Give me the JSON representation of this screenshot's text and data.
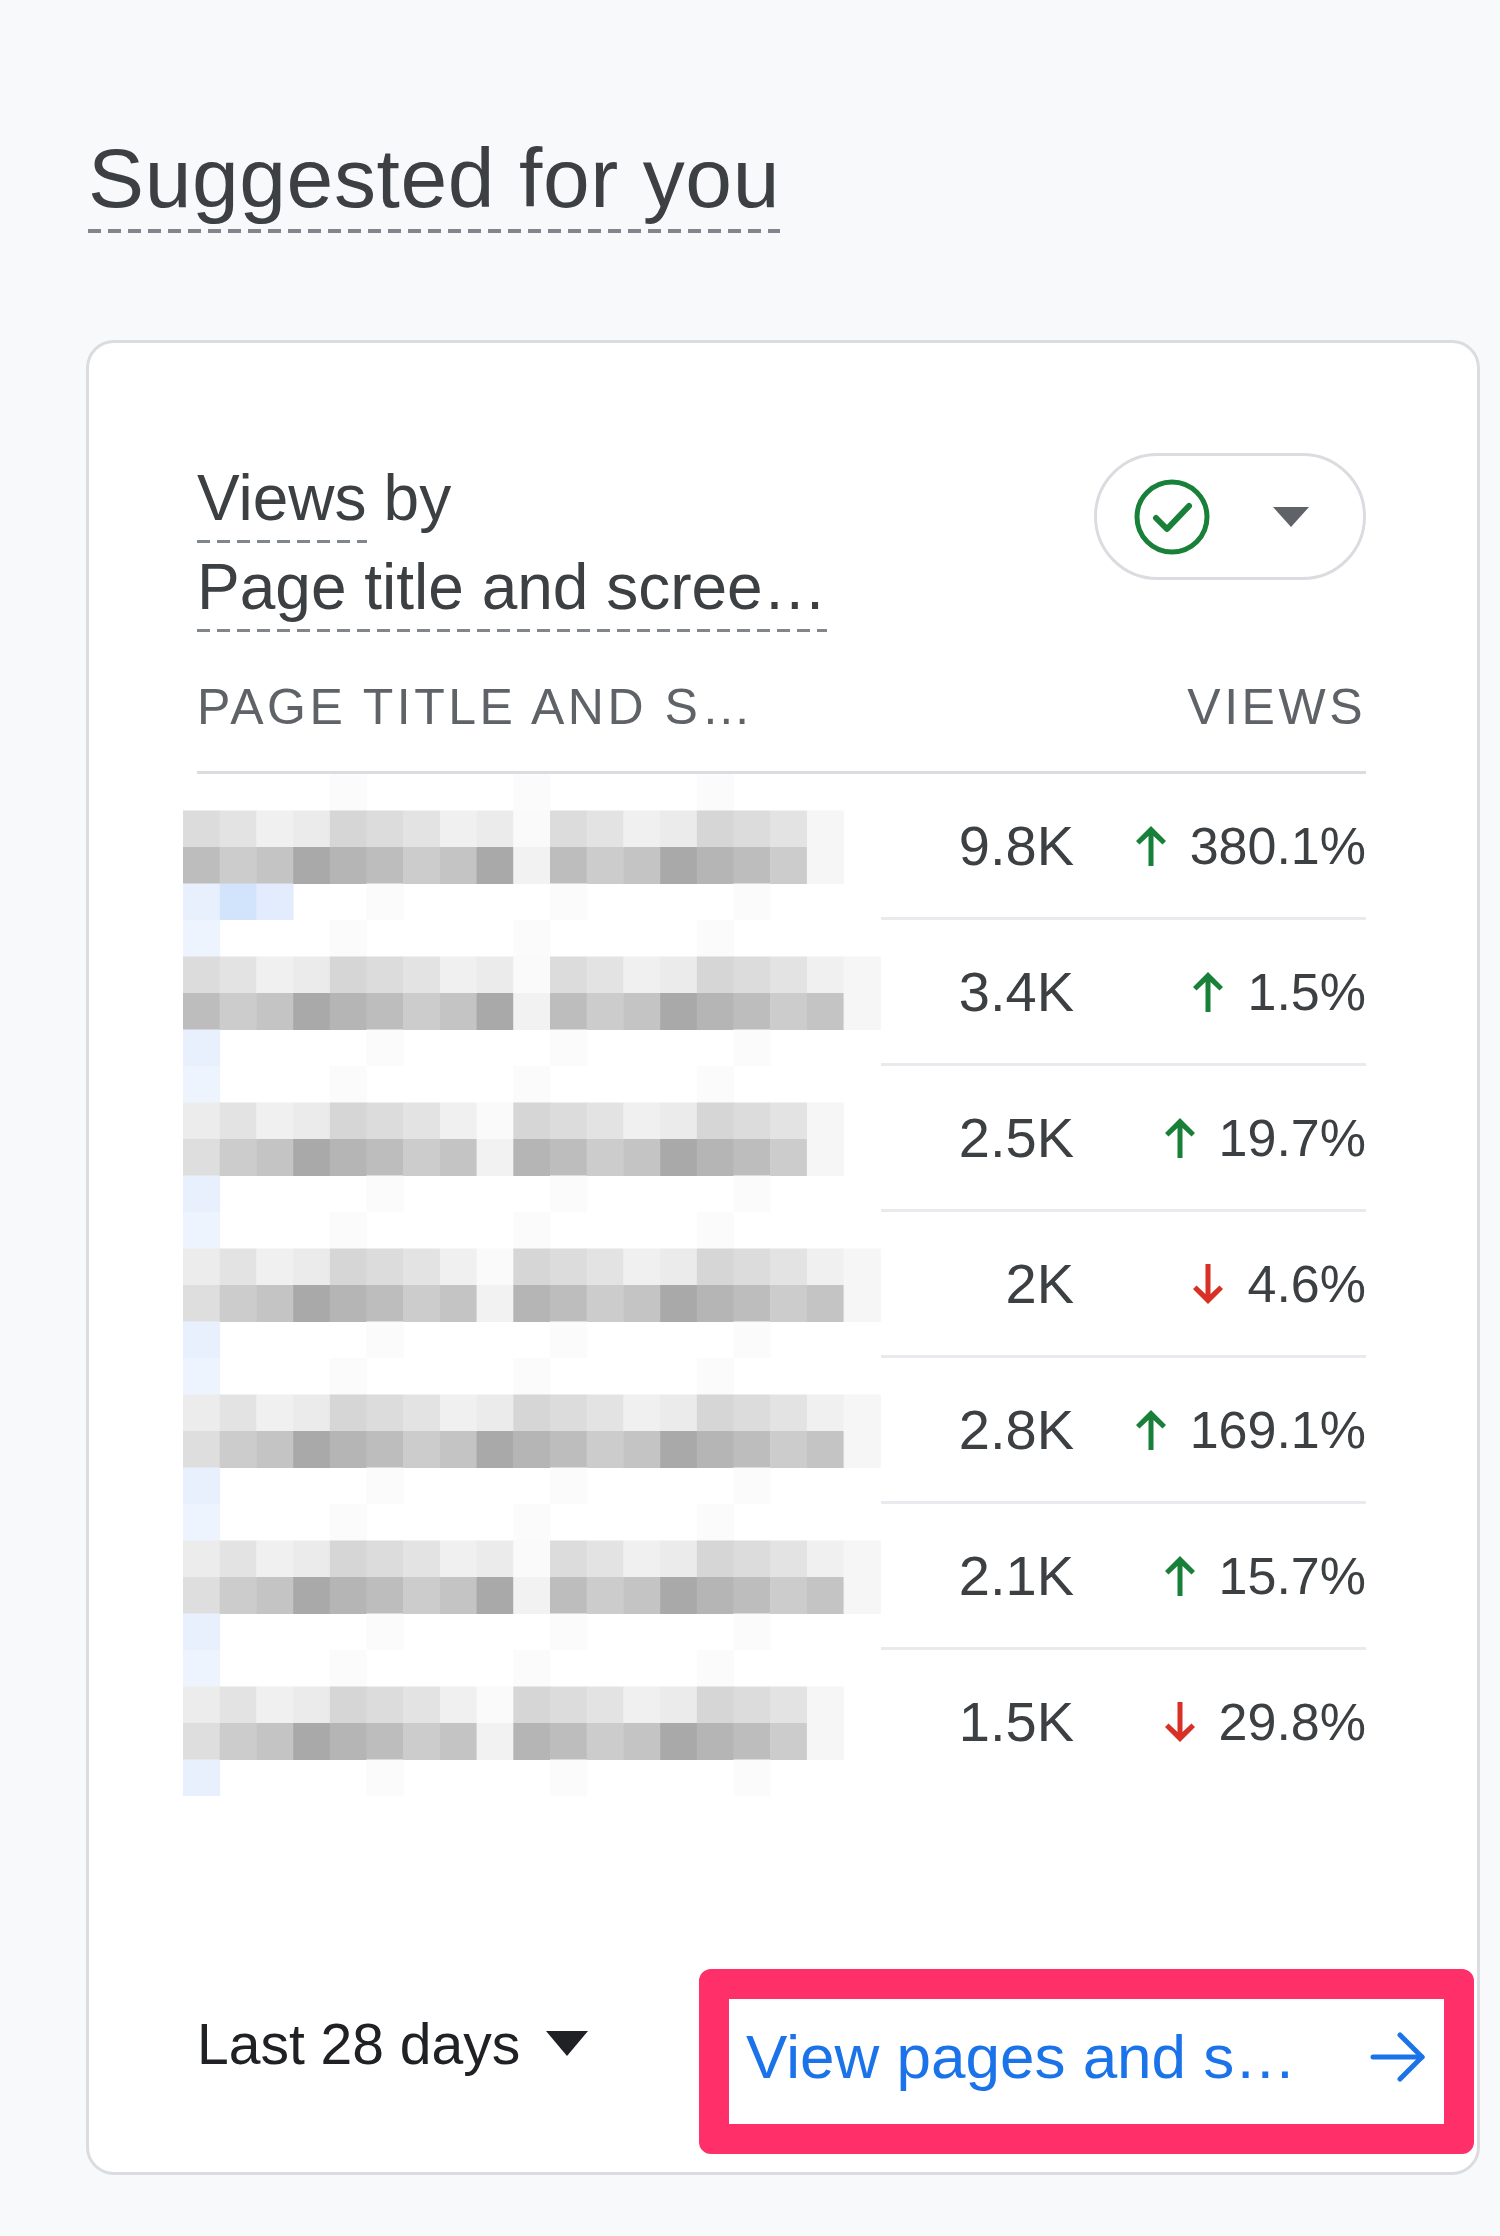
{
  "section_title": "Suggested for you",
  "card": {
    "metric": "Views",
    "connector": "by",
    "dimension": "Page title and scree…",
    "columns": [
      "PAGE TITLE AND S…",
      "VIEWS"
    ],
    "rows": [
      {
        "views": "9.8K",
        "change": "380.1%",
        "kind": "up"
      },
      {
        "views": "3.4K",
        "change": "1.5%",
        "kind": "up"
      },
      {
        "views": "2.5K",
        "change": "19.7%",
        "kind": "up"
      },
      {
        "views": "2K",
        "change": "4.6%",
        "kind": "down"
      },
      {
        "views": "2.8K",
        "change": "169.1%",
        "kind": "up"
      },
      {
        "views": "2.1K",
        "change": "15.7%",
        "kind": "up"
      },
      {
        "views": "1.5K",
        "change": "29.8%",
        "kind": "down"
      }
    ],
    "date_range": "Last 28 days",
    "link": {
      "label": "View pages and s…",
      "highlighted": true
    }
  }
}
